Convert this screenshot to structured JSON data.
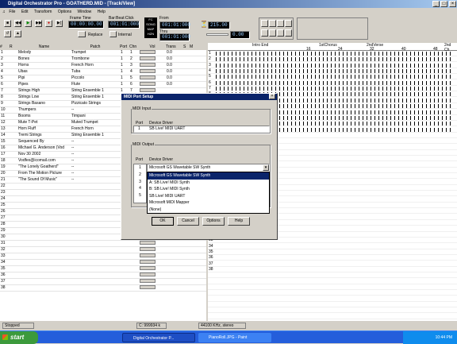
{
  "title": "Digital Orchestrator Pro - GOATHERD.MID - [Track/View]",
  "window_buttons": [
    "_",
    "□",
    "×"
  ],
  "menu": [
    "File",
    "Edit",
    "Transform",
    "Options",
    "Window",
    "Help"
  ],
  "transport": {
    "frame_time_label": "Frame Time",
    "frame_time": "00:00:00.00",
    "bar_beat_label": "Bar:Beat:Click",
    "bar_beat": "001:01:000",
    "replace_label": "Replace",
    "internal_label": "Internal",
    "from_label": "From",
    "from": "001:01:000",
    "thru_label": "Thru",
    "thru": "001:01:000",
    "tempo": "215.00",
    "transpose": "0.00"
  },
  "columns": {
    "num": "#",
    "r": "R",
    "name": "Name",
    "patch": "Patch",
    "port": "Port",
    "chn": "Chn",
    "vol": "Vol",
    "trans": "Trans",
    "s": "S",
    "m": "M"
  },
  "tracks": [
    {
      "n": "1",
      "name": "Melody",
      "patch": "Trumpet",
      "port": "1",
      "chn": "1",
      "vol": "0.0"
    },
    {
      "n": "2",
      "name": "Bones",
      "patch": "Trombone",
      "port": "1",
      "chn": "2",
      "vol": "0.0"
    },
    {
      "n": "3",
      "name": "Horns",
      "patch": "French Horn",
      "port": "1",
      "chn": "3",
      "vol": "0.0"
    },
    {
      "n": "4",
      "name": "Ubas",
      "patch": "Tuba",
      "port": "1",
      "chn": "4",
      "vol": "0.0"
    },
    {
      "n": "5",
      "name": "Pipi",
      "patch": "Piccolo",
      "port": "1",
      "chn": "5",
      "vol": "0.0"
    },
    {
      "n": "6",
      "name": "Pipes",
      "patch": "Flute",
      "port": "1",
      "chn": "6",
      "vol": "0.0"
    },
    {
      "n": "7",
      "name": "Strings High",
      "patch": "String Ensemble 1",
      "port": "1",
      "chn": "7",
      "vol": ""
    },
    {
      "n": "8",
      "name": "Strings Low",
      "patch": "String Ensemble 1",
      "port": "1",
      "chn": "8",
      "vol": ""
    },
    {
      "n": "9",
      "name": "Strings Basano",
      "patch": "Pizzicato Strings",
      "port": "1",
      "chn": "9",
      "vol": ""
    },
    {
      "n": "10",
      "name": "Thumpers",
      "patch": "--",
      "port": "",
      "chn": "",
      "vol": ""
    },
    {
      "n": "11",
      "name": "Booms",
      "patch": "Timpani",
      "port": "",
      "chn": "",
      "vol": ""
    },
    {
      "n": "12",
      "name": "Mute T-Pet",
      "patch": "Muted Trumpet",
      "port": "",
      "chn": "",
      "vol": ""
    },
    {
      "n": "13",
      "name": "Horn Fluff",
      "patch": "French Horn",
      "port": "",
      "chn": "",
      "vol": ""
    },
    {
      "n": "14",
      "name": "Tremi Strings",
      "patch": "String Ensemble 1",
      "port": "",
      "chn": "",
      "vol": ""
    },
    {
      "n": "15",
      "name": "Sequenced By",
      "patch": "--",
      "port": "",
      "chn": "",
      "vol": ""
    },
    {
      "n": "16",
      "name": "Michael G. Anderson (Vod",
      "patch": "--",
      "port": "",
      "chn": "",
      "vol": ""
    },
    {
      "n": "17",
      "name": "Nov 30 2002",
      "patch": "--",
      "port": "",
      "chn": "",
      "vol": ""
    },
    {
      "n": "18",
      "name": "Vodfex@icomail.com",
      "patch": "--",
      "port": "",
      "chn": "",
      "vol": ""
    },
    {
      "n": "19",
      "name": "\"The Lonely Goatherd\"",
      "patch": "--",
      "port": "",
      "chn": "",
      "vol": ""
    },
    {
      "n": "20",
      "name": "From The Motion Picture",
      "patch": "--",
      "port": "",
      "chn": "",
      "vol": ""
    },
    {
      "n": "21",
      "name": "\"The Sound Of Music\"",
      "patch": "--",
      "port": "",
      "chn": "",
      "vol": ""
    },
    {
      "n": "22",
      "name": "",
      "patch": "",
      "port": "",
      "chn": "",
      "vol": ""
    },
    {
      "n": "23",
      "name": "",
      "patch": "",
      "port": "",
      "chn": "",
      "vol": ""
    },
    {
      "n": "24",
      "name": "",
      "patch": "",
      "port": "",
      "chn": "",
      "vol": ""
    },
    {
      "n": "25",
      "name": "",
      "patch": "",
      "port": "",
      "chn": "",
      "vol": ""
    },
    {
      "n": "26",
      "name": "",
      "patch": "",
      "port": "",
      "chn": "",
      "vol": ""
    },
    {
      "n": "27",
      "name": "",
      "patch": "",
      "port": "",
      "chn": "",
      "vol": ""
    },
    {
      "n": "28",
      "name": "",
      "patch": "",
      "port": "",
      "chn": "",
      "vol": ""
    },
    {
      "n": "29",
      "name": "",
      "patch": "",
      "port": "",
      "chn": "",
      "vol": ""
    },
    {
      "n": "30",
      "name": "",
      "patch": "",
      "port": "",
      "chn": "",
      "vol": ""
    },
    {
      "n": "31",
      "name": "",
      "patch": "",
      "port": "",
      "chn": "",
      "vol": ""
    },
    {
      "n": "32",
      "name": "",
      "patch": "",
      "port": "",
      "chn": "",
      "vol": ""
    },
    {
      "n": "33",
      "name": "",
      "patch": "",
      "port": "",
      "chn": "",
      "vol": ""
    },
    {
      "n": "34",
      "name": "",
      "patch": "",
      "port": "",
      "chn": "",
      "vol": ""
    },
    {
      "n": "35",
      "name": "",
      "patch": "",
      "port": "",
      "chn": "",
      "vol": ""
    },
    {
      "n": "36",
      "name": "",
      "patch": "",
      "port": "",
      "chn": "",
      "vol": ""
    },
    {
      "n": "37",
      "name": "",
      "patch": "",
      "port": "",
      "chn": "",
      "vol": ""
    },
    {
      "n": "38",
      "name": "",
      "patch": "",
      "port": "",
      "chn": "",
      "vol": ""
    }
  ],
  "timeline": {
    "markers": [
      "Intro End",
      "1stChorus",
      "2ndVerse",
      "2nd Ch"
    ],
    "ticks": [
      "16",
      "24",
      "32",
      "40",
      "48"
    ]
  },
  "dialog": {
    "title": "MIDI Port Setup",
    "input_group": "MIDI Input",
    "input_port_col": "Port",
    "input_driver_col": "Device Driver",
    "input_rows": [
      {
        "port": "1",
        "driver": "SB Live! MIDI UART"
      }
    ],
    "output_group": "MIDI Output",
    "output_port_col": "Port",
    "output_driver_col": "Device Driver",
    "output_selected": "Microsoft GS Wavetable SW Synth",
    "output_port_nums": [
      "1",
      "2",
      "3",
      "4",
      "5"
    ],
    "output_options": [
      "Microsoft GS Wavetable SW Synth",
      "A: SB Live! MIDI Synth",
      "B: SB Live! MIDI Synth",
      "SB Live! MIDI UART",
      "Microsoft MIDI Mapper",
      "(None)"
    ],
    "ok": "OK",
    "cancel": "Cancel",
    "options": "Options",
    "help": "Help"
  },
  "status": {
    "state": "Stopped",
    "counter": "C: 999934 k",
    "format": "44100 KHz, stereo"
  },
  "taskbar": {
    "start": "start",
    "task1": "Digital Orchestrator P...",
    "task2": "PianoRoll.JPG - Paint",
    "clock": "10:44 PM"
  },
  "colors": {
    "title": "#0a246a",
    "selection": "#0a246a",
    "taskbar": "#245edb",
    "start": "#3c9a3c"
  }
}
